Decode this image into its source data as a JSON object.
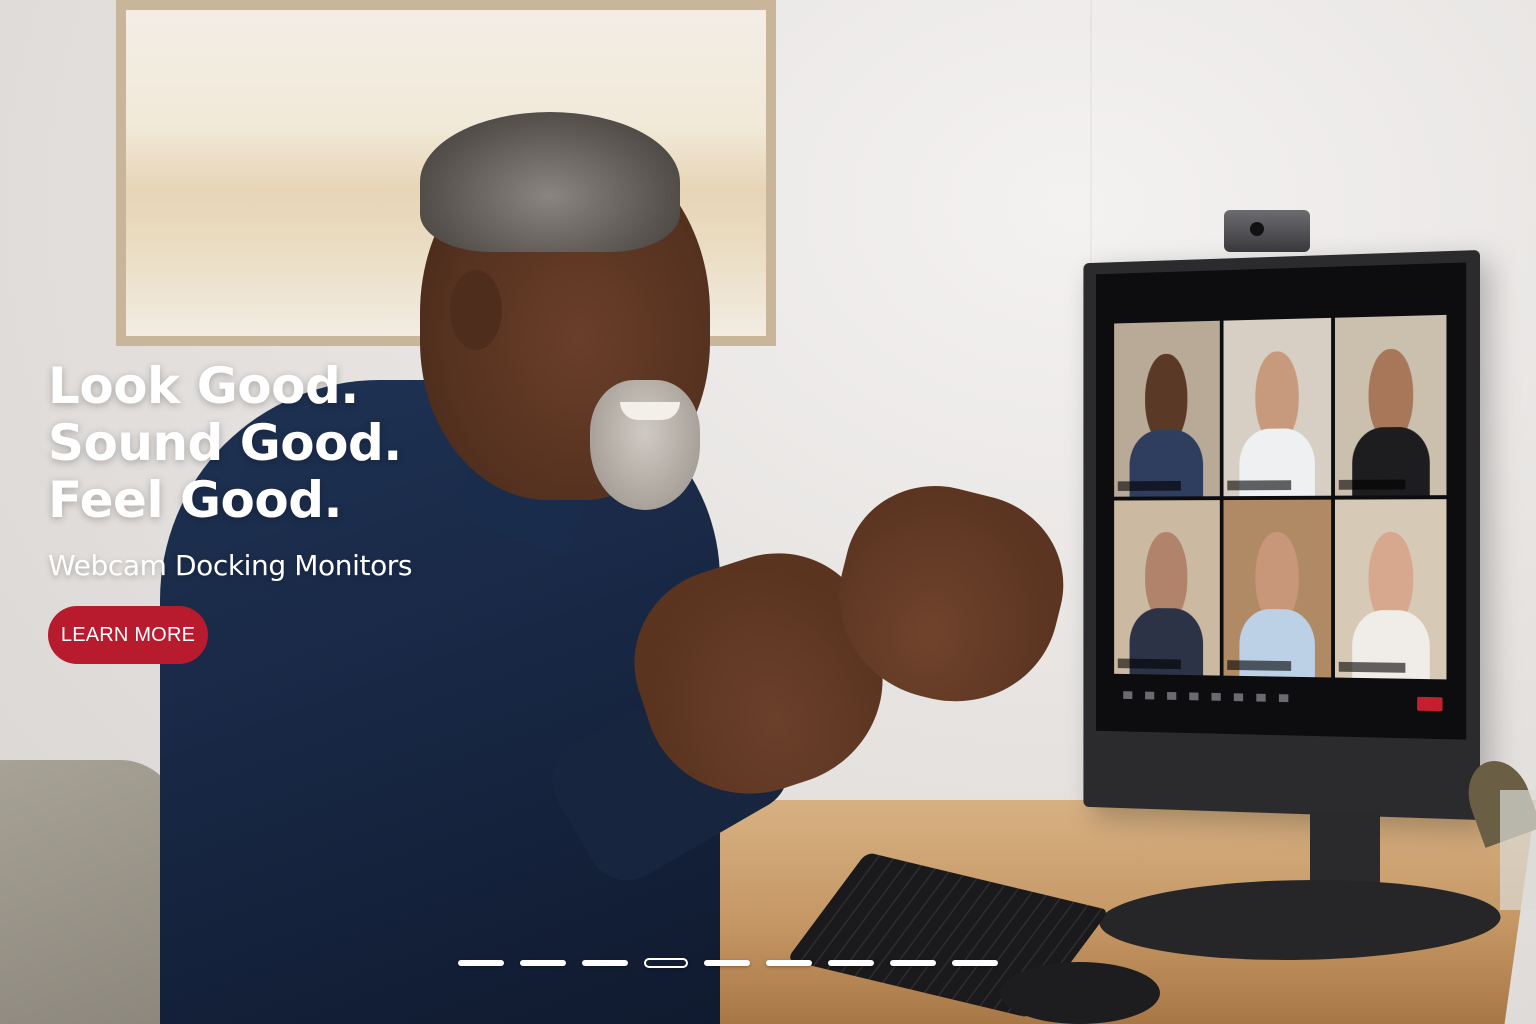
{
  "hero": {
    "headline_lines": [
      "Look Good.",
      "Sound Good.",
      "Feel Good."
    ],
    "subheadline": "Webcam Docking Monitors",
    "cta_label": "LEARN MORE",
    "accent_color": "#b81a2e"
  },
  "carousel": {
    "slide_count": 9,
    "active_index": 3
  }
}
